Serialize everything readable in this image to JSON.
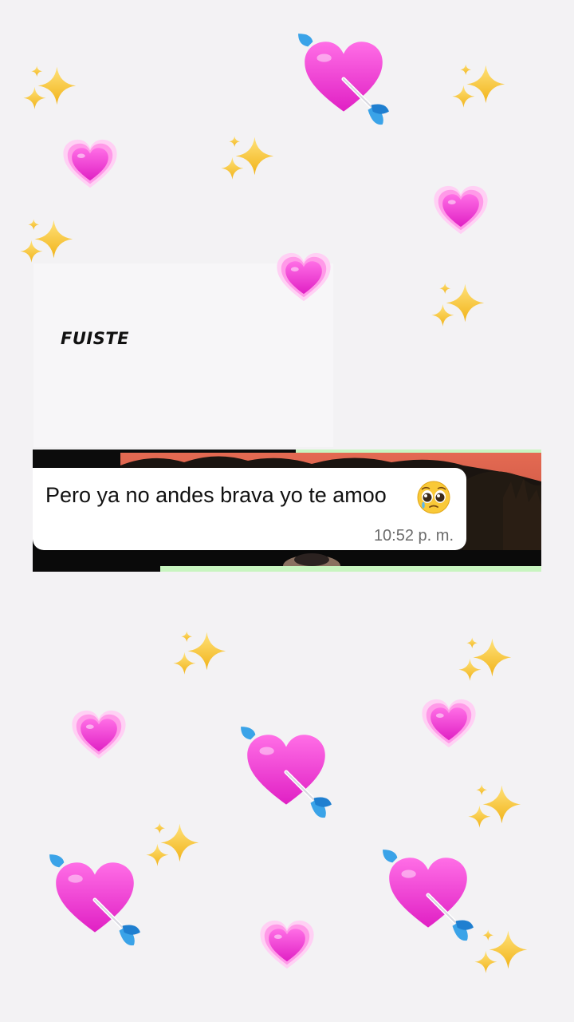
{
  "overlay": {
    "caption": "FUISTE"
  },
  "chat": {
    "message": {
      "text": "Pero ya no andes brava yo te amoo",
      "emoji": "pleading-face-icon",
      "time": "10:52 p. m."
    }
  },
  "colors": {
    "background": "#f3f2f4",
    "heart_pink": "#f23fd2",
    "sparkle_gold": "#f8c531",
    "arrow_blue": "#3aa3e8",
    "bubble": "#ffffff",
    "sky_red": "#d25a48"
  }
}
